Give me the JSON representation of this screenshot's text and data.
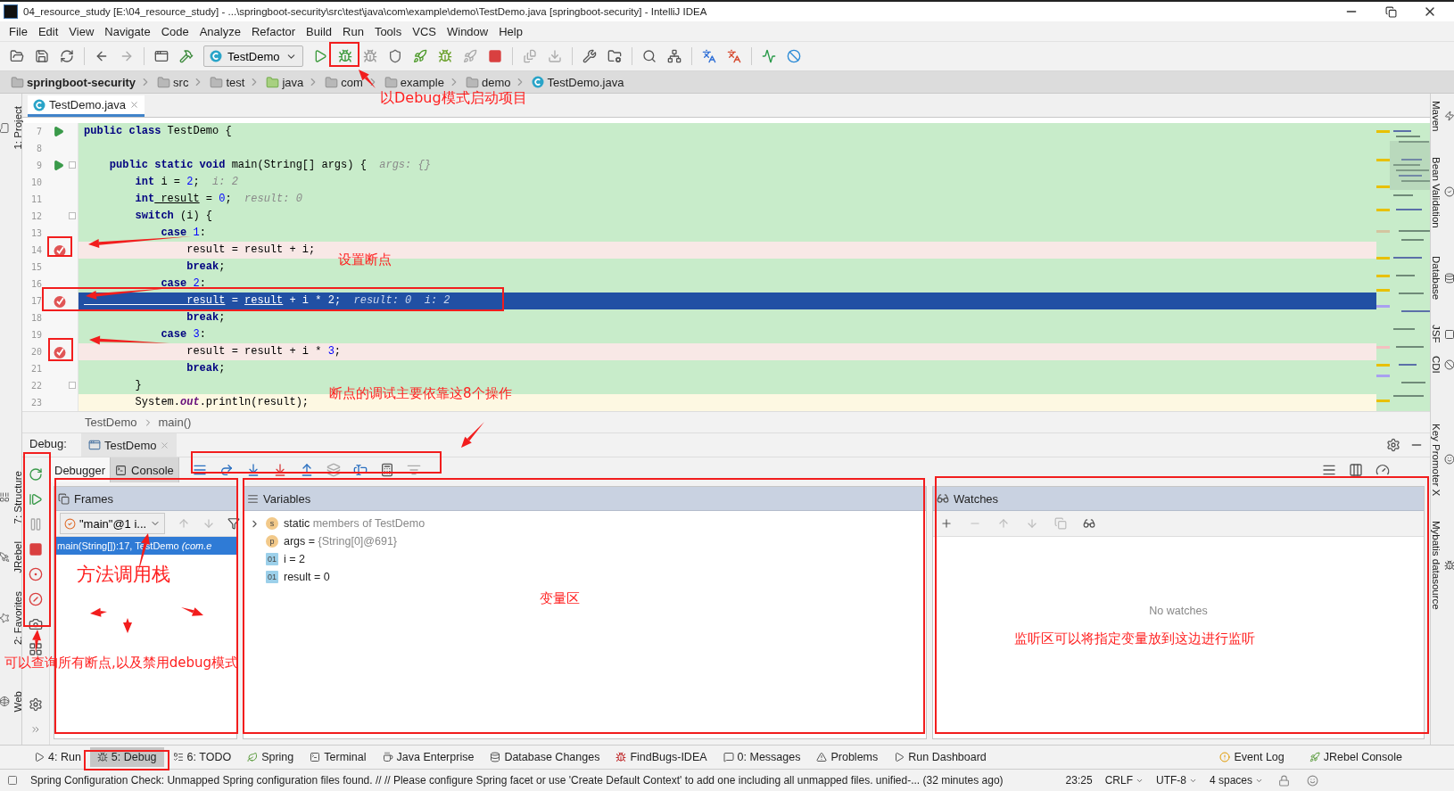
{
  "window": {
    "title": "04_resource_study [E:\\04_resource_study] - ...\\springboot-security\\src\\test\\java\\com\\example\\demo\\TestDemo.java [springboot-security] - IntelliJ IDEA"
  },
  "menu": [
    "File",
    "Edit",
    "View",
    "Navigate",
    "Code",
    "Analyze",
    "Refactor",
    "Build",
    "Run",
    "Tools",
    "VCS",
    "Window",
    "Help"
  ],
  "toolbar": {
    "run_config": "TestDemo"
  },
  "breadcrumbs": [
    {
      "label": "springboot-security",
      "kind": "module"
    },
    {
      "label": "src",
      "kind": "folder"
    },
    {
      "label": "test",
      "kind": "folder"
    },
    {
      "label": "java",
      "kind": "source"
    },
    {
      "label": "com",
      "kind": "package"
    },
    {
      "label": "example",
      "kind": "package"
    },
    {
      "label": "demo",
      "kind": "package"
    },
    {
      "label": "TestDemo.java",
      "kind": "class"
    }
  ],
  "left_tool_strip": [
    {
      "label": "1: Project"
    },
    {
      "label": "7: Structure"
    },
    {
      "label": "JRebel"
    },
    {
      "label": "2: Favorites"
    },
    {
      "label": "Web"
    }
  ],
  "right_tool_strip": [
    {
      "label": "Maven"
    },
    {
      "label": "Bean Validation"
    },
    {
      "label": "Database"
    },
    {
      "label": "JSF"
    },
    {
      "label": "CDI"
    },
    {
      "label": "Key Promoter X"
    },
    {
      "label": "Mybatis datasource"
    }
  ],
  "editor": {
    "tabs": [
      {
        "label": "TestDemo.java",
        "selected": true
      }
    ],
    "lines": [
      {
        "number": "7",
        "run_marker": true,
        "fold": false,
        "breakpoint": false,
        "current": false,
        "covered": true,
        "segments": [
          {
            "keyword": "public class"
          },
          {
            "code": " TestDemo {"
          }
        ]
      },
      {
        "number": "8",
        "run_marker": false,
        "fold": false,
        "breakpoint": false,
        "current": false,
        "covered": true
      },
      {
        "number": "9",
        "run_marker": true,
        "fold": true,
        "breakpoint": false,
        "current": false,
        "covered": true,
        "segments": [
          {
            "keyword": "    public static void"
          },
          {
            "code": " main(String[] args) {  "
          },
          {
            "hint": "args: {}"
          }
        ]
      },
      {
        "number": "10",
        "run_marker": false,
        "fold": false,
        "breakpoint": false,
        "current": false,
        "covered": true,
        "segments": [
          {
            "keyword": "        int"
          },
          {
            "code": " i = "
          },
          {
            "number": "2"
          },
          {
            "code": ";  "
          },
          {
            "hint": "i: 2"
          }
        ]
      },
      {
        "number": "11",
        "run_marker": false,
        "fold": false,
        "breakpoint": false,
        "current": false,
        "covered": true,
        "segments": [
          {
            "keyword": "        int"
          },
          {
            "underlined": " result"
          },
          {
            "code": " = "
          },
          {
            "number": "0"
          },
          {
            "code": ";  "
          },
          {
            "hint": "result: 0"
          }
        ]
      },
      {
        "number": "12",
        "run_marker": false,
        "fold": true,
        "breakpoint": false,
        "current": false,
        "covered": true,
        "segments": [
          {
            "keyword": "        switch"
          },
          {
            "code": " (i) {"
          }
        ]
      },
      {
        "number": "13",
        "run_marker": false,
        "fold": false,
        "breakpoint": false,
        "current": false,
        "covered": true,
        "segments": [
          {
            "keyword": "            case"
          },
          {
            "number": " 1"
          },
          {
            "code": ":"
          }
        ]
      },
      {
        "number": "14",
        "run_marker": false,
        "fold": false,
        "breakpoint": true,
        "current": false,
        "covered": true,
        "segments": [
          {
            "code": "                result = result + i;"
          }
        ]
      },
      {
        "number": "15",
        "run_marker": false,
        "fold": false,
        "breakpoint": false,
        "current": false,
        "covered": true,
        "segments": [
          {
            "keyword": "                break"
          },
          {
            "code": ";"
          }
        ]
      },
      {
        "number": "16",
        "run_marker": false,
        "fold": false,
        "breakpoint": false,
        "current": false,
        "covered": true,
        "segments": [
          {
            "keyword": "            case"
          },
          {
            "number": " 2"
          },
          {
            "code": ":"
          }
        ]
      },
      {
        "number": "17",
        "run_marker": false,
        "fold": false,
        "breakpoint": true,
        "current": true,
        "covered": true,
        "segments": [
          {
            "underlined": "                result"
          },
          {
            "code": " = "
          },
          {
            "underlined": "result"
          },
          {
            "code": " + i * 2;  "
          },
          {
            "hint": "result: 0  i: 2"
          }
        ]
      },
      {
        "number": "18",
        "run_marker": false,
        "fold": false,
        "breakpoint": false,
        "current": false,
        "covered": true,
        "segments": [
          {
            "keyword": "                break"
          },
          {
            "code": ";"
          }
        ]
      },
      {
        "number": "19",
        "run_marker": false,
        "fold": false,
        "breakpoint": false,
        "current": false,
        "covered": true,
        "segments": [
          {
            "keyword": "            case"
          },
          {
            "number": " 3"
          },
          {
            "code": ":"
          }
        ]
      },
      {
        "number": "20",
        "run_marker": false,
        "fold": false,
        "breakpoint": true,
        "current": false,
        "covered": true,
        "segments": [
          {
            "code": "                result = result + i * "
          },
          {
            "number": "3"
          },
          {
            "code": ";"
          }
        ]
      },
      {
        "number": "21",
        "run_marker": false,
        "fold": false,
        "breakpoint": false,
        "current": false,
        "covered": true,
        "segments": [
          {
            "keyword": "                break"
          },
          {
            "code": ";"
          }
        ]
      },
      {
        "number": "22",
        "run_marker": false,
        "fold": true,
        "breakpoint": false,
        "current": false,
        "covered": true,
        "segments": [
          {
            "code": "        }"
          }
        ]
      },
      {
        "number": "23",
        "run_marker": false,
        "fold": false,
        "breakpoint": false,
        "current": false,
        "covered": false,
        "segments": [
          {
            "code": "        System."
          },
          {
            "field": "out"
          },
          {
            "code": ".println(result);"
          }
        ]
      }
    ],
    "breadcrumb": [
      "TestDemo",
      "main()"
    ]
  },
  "debug": {
    "label": "Debug:",
    "sessions": [
      {
        "label": "TestDemo",
        "selected": true
      }
    ],
    "tabs": [
      {
        "label": "Debugger",
        "selected": true
      },
      {
        "label": "Console",
        "selected": false
      }
    ],
    "frames": {
      "title": "Frames",
      "thread": "\"main\"@1 i...",
      "items": [
        {
          "text": "main(String[]):17, TestDemo *(com.e*",
          "selected": true
        }
      ]
    },
    "variables": {
      "title": "Variables",
      "items": [
        {
          "badge": "s",
          "kind": "static",
          "name": "static",
          "value": "members of TestDemo",
          "expandable": true
        },
        {
          "badge": "p",
          "kind": "param",
          "name": "args =",
          "value": "{String[0]@691}",
          "expandable": false
        },
        {
          "badge": "01",
          "kind": "primitive",
          "name": "i = 2",
          "expandable": false
        },
        {
          "badge": "01",
          "kind": "primitive",
          "name": "result = 0",
          "expandable": false
        }
      ]
    },
    "watches": {
      "title": "Watches",
      "empty_text": "No watches"
    }
  },
  "tool_windows": [
    {
      "label": "4: Run",
      "selected": false
    },
    {
      "label": "5: Debug",
      "selected": true
    },
    {
      "label": "6: TODO",
      "selected": false
    },
    {
      "label": "Spring",
      "selected": false
    },
    {
      "label": "Terminal",
      "selected": false
    },
    {
      "label": "Java Enterprise",
      "selected": false
    },
    {
      "label": "Database Changes",
      "selected": false
    },
    {
      "label": "FindBugs-IDEA",
      "selected": false
    },
    {
      "label": "0: Messages",
      "selected": false
    },
    {
      "label": "Problems",
      "selected": false
    },
    {
      "label": "Run Dashboard",
      "selected": false
    }
  ],
  "tool_windows_right": [
    {
      "label": "Event Log"
    },
    {
      "label": "JRebel Console"
    }
  ],
  "status_bar": {
    "message": "Spring Configuration Check: Unmapped Spring configuration files found. // // Please configure Spring facet or use 'Create Default Context' to add one including all unmapped files. unified-... (32 minutes ago)",
    "items": [
      "23:25",
      "CRLF",
      "UTF-8",
      "4 spaces"
    ]
  },
  "annotations": [
    "以Debug模式启动项目",
    "设置断点",
    "断点的调试主要依靠这8个操作",
    "方法调用栈",
    "变量区",
    "监听区可以将指定变量放到这边进行监听",
    "可以查询所有断点,以及禁用debug模式"
  ]
}
